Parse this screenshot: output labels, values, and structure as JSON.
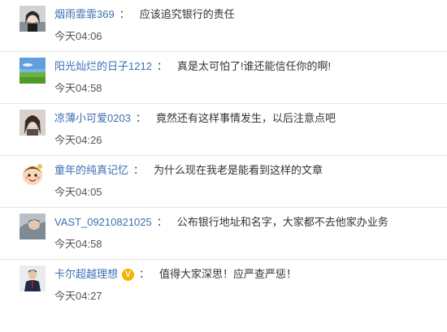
{
  "comments": [
    {
      "user": "烟雨霏霏369",
      "separator": "：",
      "text": "应该追究银行的责任",
      "time": "今天04:06",
      "avatar_icon": "user-avatar-icon"
    },
    {
      "user": "阳光灿烂的日子1212",
      "separator": "：",
      "text": "真是太可怕了!谁还能信任你的啊!",
      "time": "今天04:58",
      "avatar_icon": "landscape-avatar-icon"
    },
    {
      "user": "凉薄小可爱0203",
      "separator": "：",
      "text": "竟然还有这样事情发生，以后注意点吧",
      "time": "今天04:26",
      "avatar_icon": "user-avatar-icon"
    },
    {
      "user": "童年的纯真记忆",
      "separator": "：",
      "text": "为什么现在我老是能看到这样的文章",
      "time": "今天04:05",
      "avatar_icon": "cartoon-avatar-icon"
    },
    {
      "user": "VAST_09210821025",
      "separator": "：",
      "text": "公布银行地址和名字，大家都不去他家办业务",
      "time": "今天04:58",
      "avatar_icon": "user-avatar-icon"
    },
    {
      "user": "卡尔超越理想",
      "separator": "：",
      "text": "值得大家深思！应严查严惩！",
      "time": "今天04:27",
      "vip_badge": "V",
      "avatar_icon": "user-avatar-icon"
    }
  ],
  "colors": {
    "username": "#3d6fb3",
    "vip": "#f4b400",
    "divider": "#e6e6e6"
  }
}
